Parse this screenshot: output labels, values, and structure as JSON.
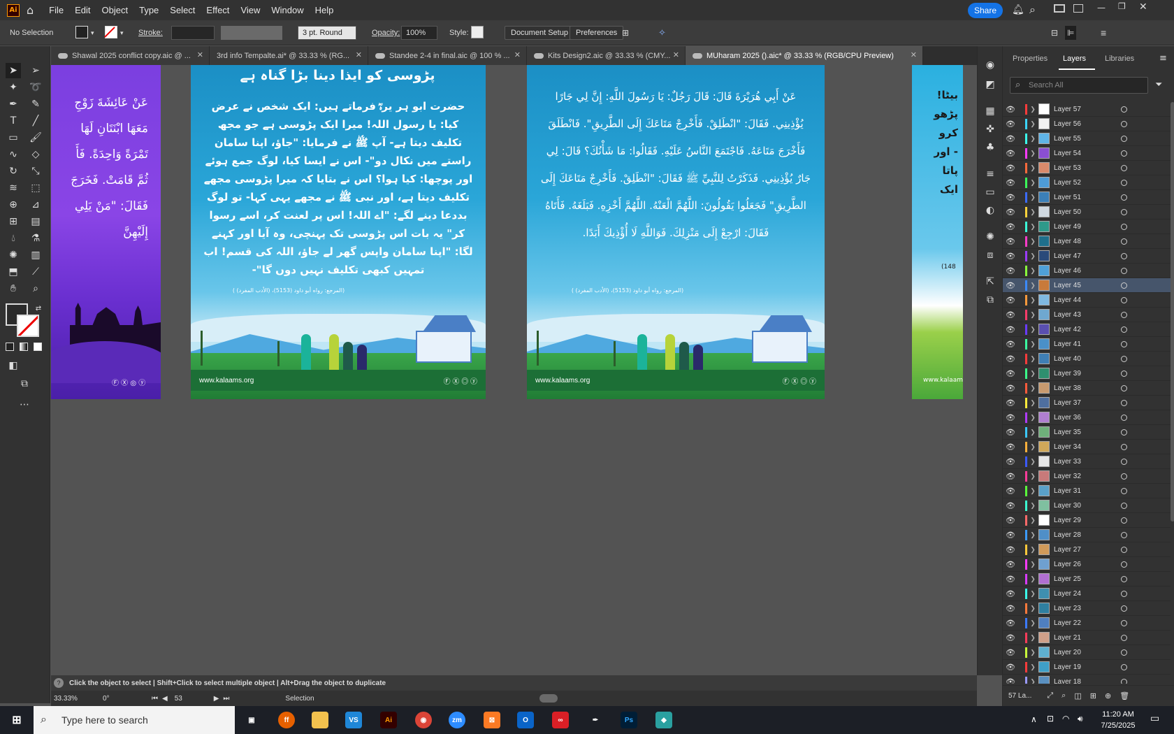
{
  "menubar": {
    "logo": "Ai",
    "items": [
      "File",
      "Edit",
      "Object",
      "Type",
      "Select",
      "Effect",
      "View",
      "Window",
      "Help"
    ],
    "share": "Share"
  },
  "control": {
    "selection": "No Selection",
    "stroke_label": "Stroke:",
    "brush": "3 pt. Round",
    "opacity_label": "Opacity:",
    "opacity": "100%",
    "style_label": "Style:",
    "document_setup": "Document Setup",
    "preferences": "Preferences"
  },
  "tabs": [
    {
      "label": "Shawal 2025 conflict copy.aic @ ..."
    },
    {
      "label": "3rd info Tempalte.ai* @ 33.33 % (RG..."
    },
    {
      "label": "Standee 2-4 in final.aic @ 100 % ..."
    },
    {
      "label": "Kits Design2.aic @ 33.33 % (CMY..."
    },
    {
      "label": "MUharam 2025 ().aic* @ 33.33 % (RGB/CPU Preview)"
    }
  ],
  "artboards": {
    "left_lines": [
      "عَنْ عَائِشَةَ زَوْجِ",
      "مَعَهَا ابْنَتَانِ لَهَا",
      "تَمْرَةً وَاحِدَةً. فَأَ",
      "ثُمَّ قَامَتْ. فَخَرَجَ",
      "فَقَالَ: \"مَنْ يَلِي",
      "إِلَيْهِنَّ"
    ],
    "urdu_title": "پڑوسی کو ایذا دینا بڑا گناہ ہے",
    "urdu_body": "حضرت ابو ہر یرہؓ فرماتے ہیں: ایک شخص نے عرض کیا: یا رسول اللہ! میرا ایک پڑوسی ہے جو مجھ تکلیف دیتا ہے- آپ ﷺ نے فرمایا: \"جاؤ، اپنا سامان راستے میں نکال دو\"- اس نے ایسا کیا، لوگ جمع ہوئے اور پوچھا: کیا ہوا؟ اس نے بتایا کہ میرا پڑوسی مجھے تکلیف دیتا ہے، اور نبی ﷺ نے مجھے یہی کہا- تو لوگ بددعا دینے لگے: \"اے اللہ! اس پر لعنت کر، اسے رسوا کر\" یہ بات اس پڑوسی تک پہنچی، وہ آیا اور کہنے لگا: \"اپنا سامان واپس گھر لے جاؤ، اللہ کی قسم! اب تمہیں کبھی تکلیف نہیں دوں گا\"-",
    "reference": "(المرجع: رواه أبو داود (5153)، (الأدب المفرد) )",
    "arabic_body": "عَنْ أَبِي هُرَيْرَةَ قَالَ: قَالَ رَجُلٌ: يَا رَسُولَ اللَّهِ: إِنَّ لِي جَارًا يُؤْذِينِي. فَقَالَ: \"انْطَلِقْ. فَأَخْرِجْ مَتَاعَكَ إِلَى الطَّرِيقِ\". فَانْطَلَقَ فَأَخْرَجَ مَتَاعَهُ. فَاجْتَمَعَ النَّاسُ عَلَيْهِ. فَقَالُوا: مَا شَأْنُكَ؟ قَالَ: لِي جَارٌ يُؤْذِينِي. فَذَكَرْتُ لِلنَّبِيِّ ﷺ فَقَالَ: \"انْطَلِقْ. فَأَخْرِجْ مَتَاعَكَ إِلَى الطَّرِيقِ\" فَجَعَلُوا يَقُولُونَ: اللَّهُمَّ الْعَنْهُ. اللَّهُمَّ أَخْزِهِ. فَبَلَغَهُ. فَأَتَاهُ فَقَالَ: ارْجِعْ إِلَى مَنْزِلِكَ. فَوَاللَّهِ لَا أُؤْذِيكَ أَبَدًا.",
    "website": "www.kalaams.org",
    "right_lines": [
      "بیٹا!",
      "پڑھو",
      "کرو",
      "- اور",
      "پاتا",
      "ایک"
    ],
    "right_ref": "(148"
  },
  "panels": {
    "tabs": [
      "Properties",
      "Layers",
      "Libraries"
    ],
    "search_placeholder": "Search All",
    "layers": [
      {
        "name": "Layer 57",
        "color": "#ff3b3b",
        "thumb": "#ffffff"
      },
      {
        "name": "Layer 56",
        "color": "#3bd5ff",
        "thumb": "#f2f2f2"
      },
      {
        "name": "Layer 55",
        "color": "#3bffec",
        "thumb": "#5fb3e6"
      },
      {
        "name": "Layer 54",
        "color": "#ff3bff",
        "thumb": "#8a4fd1"
      },
      {
        "name": "Layer 53",
        "color": "#ff6a3b",
        "thumb": "#d98a6b"
      },
      {
        "name": "Layer 52",
        "color": "#3bff5a",
        "thumb": "#4e9bd6"
      },
      {
        "name": "Layer 51",
        "color": "#3b6bff",
        "thumb": "#3b7fb8"
      },
      {
        "name": "Layer 50",
        "color": "#ffd23b",
        "thumb": "#cfd8e0"
      },
      {
        "name": "Layer 49",
        "color": "#3bffd8",
        "thumb": "#2f9a8a"
      },
      {
        "name": "Layer 48",
        "color": "#ff3bc8",
        "thumb": "#1f6f8b"
      },
      {
        "name": "Layer 47",
        "color": "#9a3bff",
        "thumb": "#2a4a7a"
      },
      {
        "name": "Layer 46",
        "color": "#8aff3b",
        "thumb": "#4fa0d8"
      },
      {
        "name": "Layer 45",
        "color": "#3b8aff",
        "thumb": "#c87a3b",
        "selected": true
      },
      {
        "name": "Layer 44",
        "color": "#ff9a3b",
        "thumb": "#7fb8e0"
      },
      {
        "name": "Layer 43",
        "color": "#ff3b6a",
        "thumb": "#6fa8d0"
      },
      {
        "name": "Layer 42",
        "color": "#6a3bff",
        "thumb": "#5a4fb0"
      },
      {
        "name": "Layer 41",
        "color": "#3bffa0",
        "thumb": "#4a90c8"
      },
      {
        "name": "Layer 40",
        "color": "#ff3b3b",
        "thumb": "#3f7fb5"
      },
      {
        "name": "Layer 39",
        "color": "#3bff8a",
        "thumb": "#2f8f6f"
      },
      {
        "name": "Layer 38",
        "color": "#ff5a3b",
        "thumb": "#c89a6f"
      },
      {
        "name": "Layer 37",
        "color": "#ffea3b",
        "thumb": "#4f6f9f"
      },
      {
        "name": "Layer 36",
        "color": "#b03bff",
        "thumb": "#b07fd0"
      },
      {
        "name": "Layer 35",
        "color": "#3bc8ff",
        "thumb": "#6fb07a"
      },
      {
        "name": "Layer 34",
        "color": "#ffb03b",
        "thumb": "#d0a85a"
      },
      {
        "name": "Layer 33",
        "color": "#3b5aff",
        "thumb": "#e6e6e6"
      },
      {
        "name": "Layer 32",
        "color": "#ff3b9a",
        "thumb": "#c87a7a"
      },
      {
        "name": "Layer 31",
        "color": "#5aff3b",
        "thumb": "#5aa0c8"
      },
      {
        "name": "Layer 30",
        "color": "#3bffd0",
        "thumb": "#7fc0a0"
      },
      {
        "name": "Layer 29",
        "color": "#ff6a6a",
        "thumb": "#ffffff"
      },
      {
        "name": "Layer 28",
        "color": "#3b9aff",
        "thumb": "#4f8fc8"
      },
      {
        "name": "Layer 27",
        "color": "#ffc83b",
        "thumb": "#d09a5a"
      },
      {
        "name": "Layer 26",
        "color": "#ff3bff",
        "thumb": "#6fa0d0"
      },
      {
        "name": "Layer 25",
        "color": "#d83bff",
        "thumb": "#b06fd0"
      },
      {
        "name": "Layer 24",
        "color": "#3bffea",
        "thumb": "#3f8fb0"
      },
      {
        "name": "Layer 23",
        "color": "#ff7a3b",
        "thumb": "#2f7fa0"
      },
      {
        "name": "Layer 22",
        "color": "#3b7aff",
        "thumb": "#4f7fc0"
      },
      {
        "name": "Layer 21",
        "color": "#ff3b5a",
        "thumb": "#d0a08a"
      },
      {
        "name": "Layer 20",
        "color": "#c8ff3b",
        "thumb": "#5fb0d0"
      },
      {
        "name": "Layer 19",
        "color": "#ff3b3b",
        "thumb": "#3f9fc8"
      },
      {
        "name": "Layer 18",
        "color": "#9a9aff",
        "thumb": "#5a90c0"
      }
    ],
    "footer_count": "57 La..."
  },
  "hint": {
    "text": "Click the object to select  |  Shift+Click to select multiple object  |  Alt+Drag the object to duplicate"
  },
  "status": {
    "zoom": "33.33%",
    "rotation": "0°",
    "artboard_num": "53",
    "tool": "Selection"
  },
  "taskbar": {
    "search": "Type here to search",
    "time": "11:20 AM",
    "date": "7/25/2025"
  }
}
